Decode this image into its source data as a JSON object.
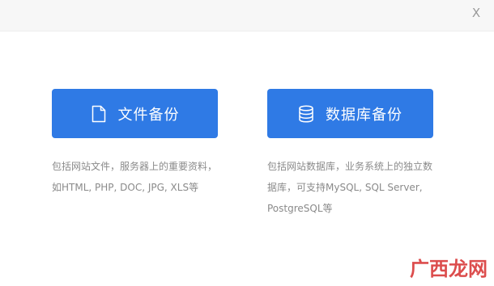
{
  "dialog": {
    "close_label": "X"
  },
  "options": {
    "file_backup": {
      "label": "文件备份",
      "icon": "document-icon",
      "description": "包括网站文件，服务器上的重要资料，如HTML, PHP, DOC, JPG, XLS等"
    },
    "database_backup": {
      "label": "数据库备份",
      "icon": "database-icon",
      "description": "包括网站数据库，业务系统上的独立数据库，可支持MySQL, SQL Server, PostgreSQL等"
    }
  },
  "watermark": {
    "text": "广西龙网"
  },
  "colors": {
    "button_bg": "#2f7ae5",
    "button_text": "#ffffff",
    "desc_text": "#8a8a8a",
    "topbar_bg": "#f7f7f7",
    "watermark": "#d93a3a"
  }
}
